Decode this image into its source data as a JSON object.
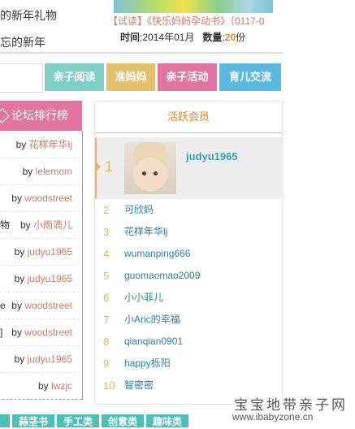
{
  "top_left": {
    "lines": [
      "的新年礼物",
      "忘的新年"
    ]
  },
  "book": {
    "title": "【试读】《快乐妈妈孕动书》（0117-0",
    "time_label": "时间",
    "time_value": ":2014年01月",
    "count_label": "数量",
    "count_value": ":",
    "count_num": "20",
    "count_unit": "份"
  },
  "nav": {
    "items": [
      {
        "label": "亲子阅读",
        "color": "#7fcfc4"
      },
      {
        "label": "准妈妈",
        "color": "#e3c06b"
      },
      {
        "label": "亲子活动",
        "color": "#e0759f"
      },
      {
        "label": "育儿交流",
        "color": "#5bb8de"
      }
    ]
  },
  "ranking": {
    "title": "论坛排行榜",
    "rows": [
      {
        "pre": "",
        "by": "by",
        "user": "花样年华lj"
      },
      {
        "pre": "",
        "by": "by",
        "user": "lelemom"
      },
      {
        "pre": "",
        "by": "by",
        "user": "woodstreet"
      },
      {
        "pre": "物",
        "by": "by",
        "user": "小雨滴儿"
      },
      {
        "pre": "",
        "by": "by",
        "user": "judyu1965"
      },
      {
        "pre": "",
        "by": "by",
        "user": "judyu1965"
      },
      {
        "pre": "e",
        "by": "by",
        "user": "woodstreet"
      },
      {
        "pre": "]",
        "by": "by",
        "user": "woodstreet"
      },
      {
        "pre": "",
        "by": "by",
        "user": "judyu1965"
      },
      {
        "pre": "",
        "by": "by",
        "user": "lwzjc"
      }
    ]
  },
  "active": {
    "title": "活跃会员",
    "first": {
      "rank": "1",
      "name": "judyu1965"
    },
    "members": [
      {
        "rank": "2",
        "name": "可欣妈"
      },
      {
        "rank": "3",
        "name": "花样年华lj"
      },
      {
        "rank": "4",
        "name": "wumanping666"
      },
      {
        "rank": "5",
        "name": "guomaomao2009"
      },
      {
        "rank": "6",
        "name": "小小菲儿"
      },
      {
        "rank": "7",
        "name": "小Aric的幸福"
      },
      {
        "rank": "8",
        "name": "qianqian0901"
      },
      {
        "rank": "9",
        "name": "happy栎阳"
      },
      {
        "rank": "10",
        "name": "智密密"
      }
    ]
  },
  "bottom_tabs": [
    "",
    "蒜茎书",
    "手工类",
    "创意类",
    "趣味类"
  ],
  "watermark": {
    "line1": "宝宝地带亲子网",
    "line2": "www.ibabyzone.cn"
  }
}
